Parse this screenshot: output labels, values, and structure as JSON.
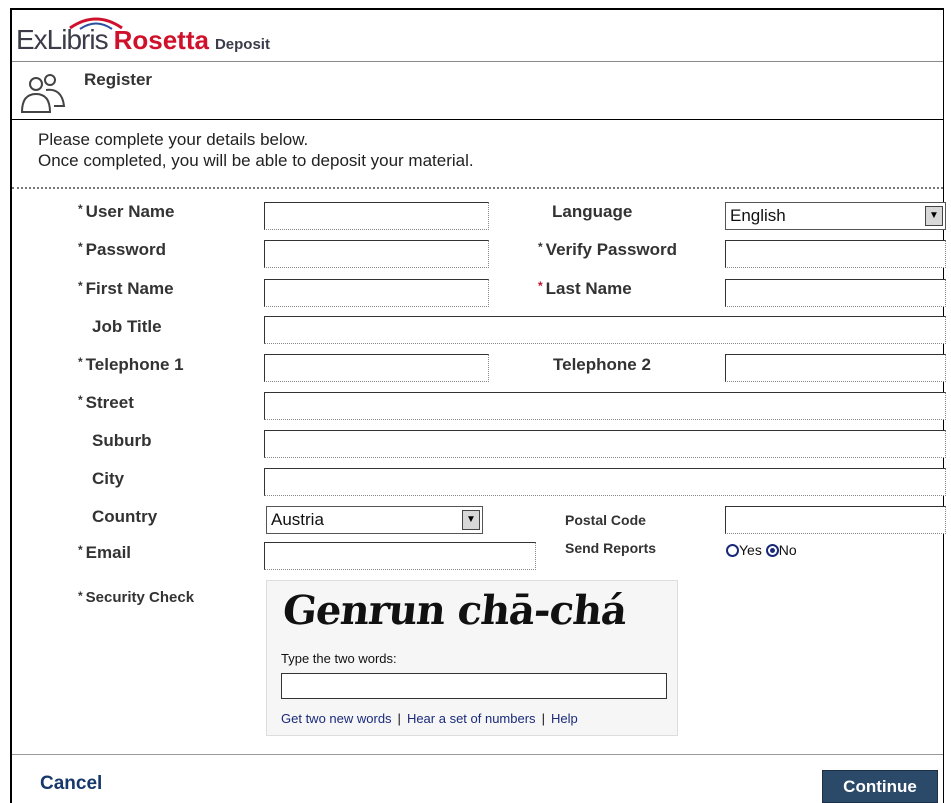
{
  "header": {
    "logo_exlibris": "ExLibris",
    "logo_rosetta": "Rosetta",
    "logo_deposit": "Deposit",
    "brand_red": "#d0112b"
  },
  "page": {
    "title": "Register",
    "icon": "users-icon",
    "instructions_line1": "Please complete your details below.",
    "instructions_line2": "Once completed, you will be able to deposit your material."
  },
  "form": {
    "required_mark": "*",
    "user_name_label": "User Name",
    "language_label": "Language",
    "language_value": "English",
    "password_label": "Password",
    "verify_password_label": "Verify Password",
    "first_name_label": "First Name",
    "last_name_label": "Last Name",
    "job_title_label": "Job Title",
    "telephone1_label": "Telephone 1",
    "telephone2_label": "Telephone 2",
    "street_label": "Street",
    "suburb_label": "Suburb",
    "city_label": "City",
    "country_label": "Country",
    "country_value": "Austria",
    "postal_code_label": "Postal Code",
    "email_label": "Email",
    "send_reports_label": "Send Reports",
    "send_reports_yes": "Yes",
    "send_reports_no": "No",
    "send_reports_selected": "No",
    "security_check_label": "Security Check"
  },
  "captcha": {
    "words": "Genrun chā-chá",
    "prompt": "Type the two words:",
    "link_new_words": "Get two new words",
    "link_audio": "Hear a set of numbers",
    "link_help": "Help"
  },
  "footer": {
    "cancel_label": "Cancel",
    "continue_label": "Continue",
    "continue_color": "#2b4968"
  }
}
